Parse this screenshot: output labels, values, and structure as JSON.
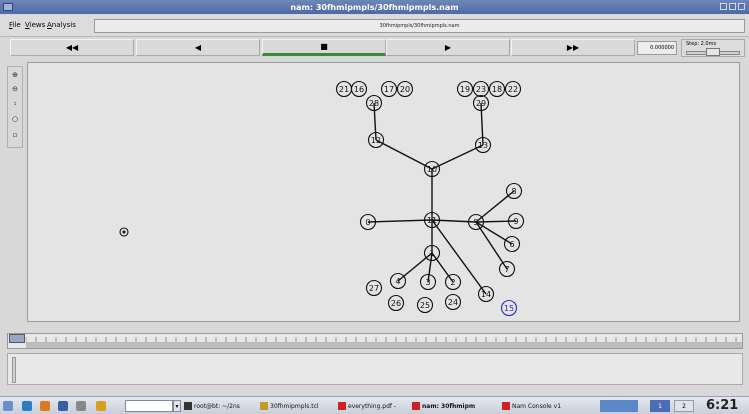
{
  "window": {
    "title": "nam: 30fhmipmpls/30fhmipmpls.nam"
  },
  "menu": {
    "file": "File",
    "views": "Views",
    "analysis": "Analysis",
    "filename": "30fhmipmpls/30fhmipmpls.nam"
  },
  "transport": {
    "rewind": "◀◀",
    "back": "◀",
    "stop": "■",
    "play": "▶",
    "fastforward": "▶▶",
    "time": "0.000000",
    "step_label": "Step: 2.0ms"
  },
  "tools": {
    "zoom_in": "⊕",
    "zoom_out": "⊖",
    "flip": "↕",
    "circle": "○",
    "small": "▫"
  },
  "topology": {
    "node_stroke": "#111111",
    "link_stroke": "#111111",
    "highlight_color": "#2a2ad0",
    "nodes": [
      {
        "id": "0"
      },
      {
        "id": "1"
      },
      {
        "id": "2"
      },
      {
        "id": "3"
      },
      {
        "id": "4"
      },
      {
        "id": "5"
      },
      {
        "id": "6"
      },
      {
        "id": "7"
      },
      {
        "id": "8"
      },
      {
        "id": "9"
      },
      {
        "id": "10"
      },
      {
        "id": "11"
      },
      {
        "id": "12"
      },
      {
        "id": "13"
      },
      {
        "id": "14"
      },
      {
        "id": "15",
        "highlight": true
      },
      {
        "id": "16"
      },
      {
        "id": "17"
      },
      {
        "id": "18"
      },
      {
        "id": "19"
      },
      {
        "id": "20"
      },
      {
        "id": "21"
      },
      {
        "id": "22"
      },
      {
        "id": "23"
      },
      {
        "id": "24"
      },
      {
        "id": "25"
      },
      {
        "id": "26"
      },
      {
        "id": "27"
      },
      {
        "id": "28"
      },
      {
        "id": "29"
      },
      {
        "id": ""
      }
    ],
    "links": [
      [
        "28",
        "12"
      ],
      [
        "12",
        "10"
      ],
      [
        "29",
        "13"
      ],
      [
        "13",
        "10"
      ],
      [
        "10",
        "11"
      ],
      [
        "0",
        "11"
      ],
      [
        "11",
        "5"
      ],
      [
        "5",
        "8"
      ],
      [
        "5",
        "9"
      ],
      [
        "5",
        "6"
      ],
      [
        "5",
        "7"
      ],
      [
        "11",
        "1"
      ],
      [
        "11",
        "14"
      ],
      [
        "1",
        "4"
      ],
      [
        "1",
        "3"
      ],
      [
        "1",
        "2"
      ]
    ]
  },
  "taskbar": {
    "tasks": [
      {
        "label": "root@bt: ~/2ns",
        "bold": false
      },
      {
        "label": "30fhmipmpls.tcl",
        "bold": false
      },
      {
        "label": "everything.pdf -",
        "bold": false
      },
      {
        "label": "nam: 30fhmipm",
        "bold": true
      },
      {
        "label": "Nam Console v1",
        "bold": false
      }
    ],
    "tray": [
      "1",
      "2"
    ],
    "clock": "6:21"
  }
}
